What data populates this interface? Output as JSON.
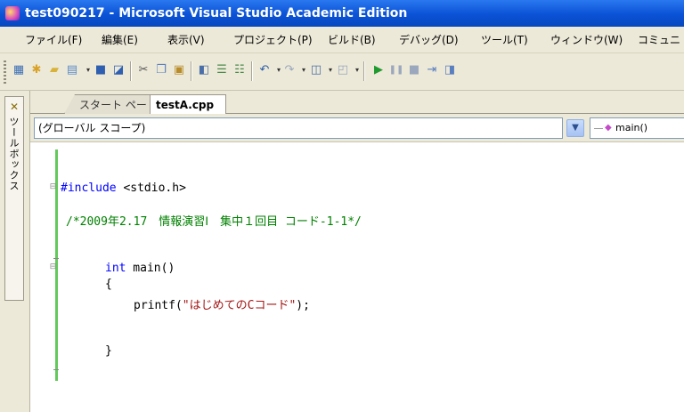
{
  "window": {
    "title": "test090217 - Microsoft Visual Studio Academic Edition"
  },
  "menu": [
    "ファイル(F)",
    "編集(E)",
    "表示(V)",
    "プロジェクト(P)",
    "ビルド(B)",
    "デバッグ(D)",
    "ツール(T)",
    "ウィンドウ(W)",
    "コミュニ"
  ],
  "toolbar": {
    "icons": [
      "new-project-icon",
      "add-item-icon",
      "open-file-icon",
      "solution-explorer-icon",
      "save-icon",
      "save-all-icon",
      "cut-icon",
      "copy-icon",
      "paste-icon",
      "find-icon",
      "comment-icon",
      "uncomment-icon",
      "undo-icon",
      "redo-icon",
      "navigate-icon",
      "browse-icon",
      "start-debug-icon",
      "pause-icon",
      "stop-icon",
      "step-icon",
      "window-icon"
    ]
  },
  "toolbox": {
    "label": "ツールボックス"
  },
  "tabs": {
    "inactive_label": "スタート ページ",
    "active_label": "testA.cpp"
  },
  "scope": {
    "value": "(グローバル スコープ)",
    "member": "main()"
  },
  "code": {
    "include_kw": "#include",
    "include_target": " <stdio.h>",
    "comment": "/*2009年2.17　情報演習Ⅰ　集中１回目 コード-1-1*/",
    "int_kw": "int",
    "main_sig": " main()",
    "open_brace": "{",
    "printf_call": "printf(",
    "printf_string": "\"はじめてのCコード\"",
    "printf_end": ");",
    "close_brace": "}"
  },
  "colors": {
    "titlebar": "#0a52d6",
    "chrome": "#ece9d8",
    "keyword": "#0000ff",
    "string": "#a31515",
    "comment": "#008000",
    "change_bar": "#63c95b"
  }
}
